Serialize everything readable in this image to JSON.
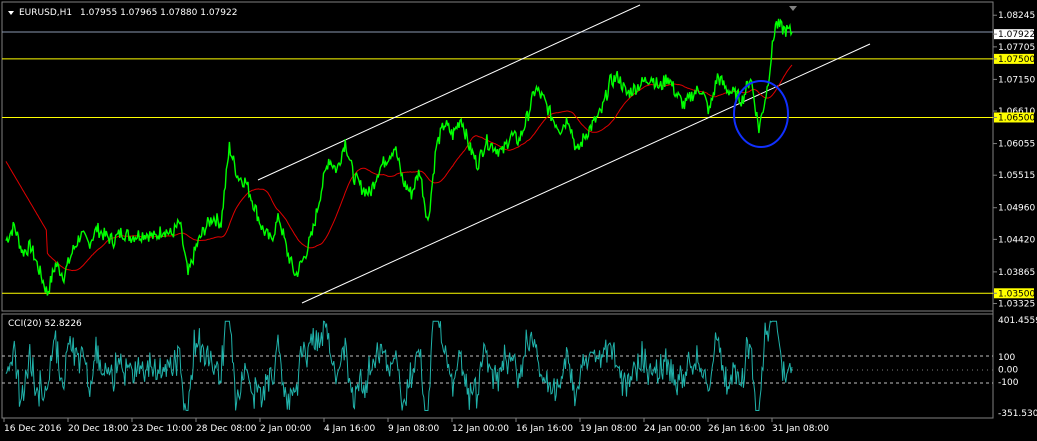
{
  "header": {
    "symbol": "EURUSD,H1",
    "ohlc": "1.07955 1.07965 1.07880 1.07922",
    "menu_icon": "triangle-down-icon"
  },
  "indicator_header": "CCI(20) 52.8226",
  "colors": {
    "background": "#000000",
    "price": "#00ff00",
    "ma": "#ff0000",
    "channel": "#ffffff",
    "hline": "#ffff00",
    "circle": "#1030ff",
    "cci": "#20b2aa",
    "grid": "#808080"
  },
  "chart_data": [
    {
      "type": "line",
      "title": "EURUSD,H1",
      "y_ticks": [
        "1.08245",
        "1.07922",
        "1.07705",
        "1.07500",
        "1.07150",
        "1.06610",
        "1.06500",
        "1.06055",
        "1.05515",
        "1.04960",
        "1.04420",
        "1.03865",
        "1.03500",
        "1.03325"
      ],
      "ylim": [
        1.033,
        1.083
      ],
      "highlighted_levels": [
        "1.07922",
        "1.07500",
        "1.06500",
        "1.03500"
      ],
      "x_labels": [
        "16 Dec 2016",
        "20 Dec 18:00",
        "23 Dec 10:00",
        "28 Dec 08:00",
        "2 Jan 00:00",
        "4 Jan 16:00",
        "9 Jan 08:00",
        "12 Jan 00:00",
        "16 Jan 16:00",
        "19 Jan 08:00",
        "24 Jan 00:00",
        "26 Jan 16:00",
        "31 Jan 08:00"
      ],
      "series": [
        {
          "values": [
            1.044,
            1.0465,
            1.042,
            1.043,
            1.039,
            1.035,
            1.04,
            1.038,
            1.042,
            1.045,
            1.0435,
            1.046,
            1.0448,
            1.044,
            1.0455,
            1.0447,
            1.045,
            1.0452,
            1.0445,
            1.046,
            1.045,
            1.047,
            1.038,
            1.043,
            1.046,
            1.048,
            1.047,
            1.06,
            1.055,
            1.054,
            1.05,
            1.046,
            1.044,
            1.048,
            1.042,
            1.038,
            1.041,
            1.045,
            1.052,
            1.058,
            1.056,
            1.061,
            1.055,
            1.053,
            1.052,
            1.056,
            1.058,
            1.06,
            1.054,
            1.052,
            1.056,
            1.047,
            1.06,
            1.064,
            1.062,
            1.065,
            1.06,
            1.057,
            1.061,
            1.06,
            1.059,
            1.062,
            1.061,
            1.065,
            1.07,
            1.068,
            1.065,
            1.063,
            1.065,
            1.059,
            1.062,
            1.064,
            1.066,
            1.071,
            1.072,
            1.069,
            1.07,
            1.071,
            1.072,
            1.07,
            1.072,
            1.069,
            1.067,
            1.069,
            1.07,
            1.066,
            1.072,
            1.07,
            1.069,
            1.068,
            1.072,
            1.063,
            1.07,
            1.081,
            1.08,
            1.0795
          ]
        }
      ]
    },
    {
      "type": "line",
      "title": "CCI(20) 52.8226",
      "y_ticks": [
        "401.4559",
        "100",
        "0.00",
        "-100",
        "-351.5301"
      ],
      "ylim": [
        -351.5301,
        401.4559
      ],
      "levels": [
        100,
        0,
        -100
      ]
    }
  ]
}
